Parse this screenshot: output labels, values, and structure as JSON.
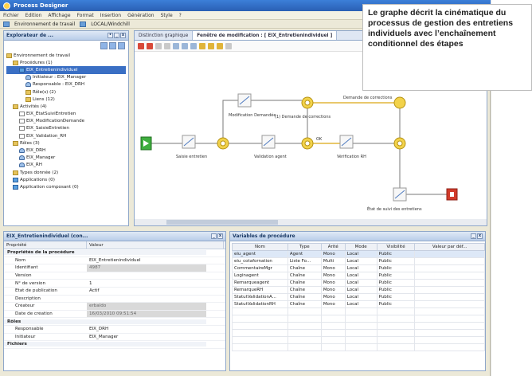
{
  "window": {
    "title": "Process Designer"
  },
  "menu": [
    "Fichier",
    "Edition",
    "Affichage",
    "Format",
    "Insertion",
    "Génération",
    "Style",
    "?"
  ],
  "workspace_bar": {
    "label": "Environnement de travail",
    "path": "LOCAL/Windchill"
  },
  "explorer": {
    "title": "Explorateur de ...",
    "tree": [
      {
        "label": "Environnement de travail",
        "depth": 0,
        "icon": "folder-icon"
      },
      {
        "label": "Procédures (1)",
        "depth": 1,
        "icon": "folder-icon"
      },
      {
        "label": "EIX_Entretienindividuel",
        "depth": 2,
        "icon": "process-icon",
        "selected": true
      },
      {
        "label": "Initiateur : EIX_Manager",
        "depth": 3,
        "icon": "person-icon"
      },
      {
        "label": "Responsable : EIX_DRH",
        "depth": 3,
        "icon": "person-icon"
      },
      {
        "label": "Rôle(s) (2)",
        "depth": 3,
        "icon": "folder-icon"
      },
      {
        "label": "Liens (12)",
        "depth": 3,
        "icon": "folder-icon"
      },
      {
        "label": "Activités (4)",
        "depth": 1,
        "icon": "folder-icon"
      },
      {
        "label": "EIX_ÉtatSuiviEntretien",
        "depth": 2,
        "icon": "document-icon"
      },
      {
        "label": "EIX_ModificationDemande",
        "depth": 2,
        "icon": "document-icon"
      },
      {
        "label": "EIX_SaisieEntretien",
        "depth": 2,
        "icon": "document-icon"
      },
      {
        "label": "EIX_Validation_RH",
        "depth": 2,
        "icon": "document-icon"
      },
      {
        "label": "Rôles (3)",
        "depth": 1,
        "icon": "folder-icon"
      },
      {
        "label": "EIX_DRH",
        "depth": 2,
        "icon": "person-icon"
      },
      {
        "label": "EIX_Manager",
        "depth": 2,
        "icon": "person-icon"
      },
      {
        "label": "EIX_RH",
        "depth": 2,
        "icon": "person-icon"
      },
      {
        "label": "Types donnée (2)",
        "depth": 1,
        "icon": "folder-icon"
      },
      {
        "label": "Applications (0)",
        "depth": 1,
        "icon": "database-icon"
      },
      {
        "label": "Application composant (0)",
        "depth": 1,
        "icon": "database-icon"
      }
    ]
  },
  "editor": {
    "tabs": [
      "Distinction graphique",
      "Fenêtre de modification : [ EIX_Entretienindividuel ]"
    ],
    "nodes": {
      "start": "",
      "saisie": "Saisie entretien",
      "validation": "Validation agent",
      "modification": "Modification Demandée",
      "verification": "Vérification RH",
      "etat": "État de suivi des entretiens",
      "end": ""
    },
    "edge_labels": {
      "demande": "(1) Demande de corrections",
      "demande_top": "Demande de corrections",
      "ok": "OK"
    }
  },
  "callout": {
    "text": "Le graphe décrit la cinématique du processus de gestion des entretiens individuels avec l’enchaînement conditionnel des étapes"
  },
  "properties": {
    "title": "EIX_Entretienindividuel (con...",
    "columns": [
      "Propriété",
      "Valeur"
    ],
    "rows": [
      {
        "key": "Propriétés de la procédure",
        "value": "",
        "group": true
      },
      {
        "key": "Nom",
        "value": "EIX_Entretienindividuel",
        "group": false,
        "ro": false
      },
      {
        "key": "Identifiant",
        "value": "4987",
        "group": false,
        "ro": true
      },
      {
        "key": "Version",
        "value": "",
        "group": false,
        "ro": false
      },
      {
        "key": "N° de version",
        "value": "1",
        "group": false,
        "ro": false
      },
      {
        "key": "État de publication",
        "value": "Actif",
        "group": false,
        "ro": false
      },
      {
        "key": "Description",
        "value": "",
        "group": false,
        "ro": false
      },
      {
        "key": "Créateur",
        "value": "erbaldo",
        "group": false,
        "ro": true
      },
      {
        "key": "Date de création",
        "value": "16/03/2010 09:51:54",
        "group": false,
        "ro": true
      },
      {
        "key": "Rôles",
        "value": "",
        "group": true
      },
      {
        "key": "Responsable",
        "value": "EIX_DRH",
        "group": false,
        "ro": false
      },
      {
        "key": "Initiateur",
        "value": "EIX_Manager",
        "group": false,
        "ro": false
      },
      {
        "key": "Fichiers",
        "value": "",
        "group": true
      }
    ]
  },
  "variables": {
    "title": "Variables de procédure",
    "columns": [
      "Nom",
      "Type",
      "Arité",
      "Mode",
      "Visibilité",
      "Valeur par déf..."
    ],
    "rows": [
      [
        "eiu_agent",
        "Agent",
        "Mono",
        "Local",
        "Public",
        ""
      ],
      [
        "eiu_cotafornation",
        "Liste Fo...",
        "Multi",
        "Local",
        "Public",
        ""
      ],
      [
        "CommentaireMgr",
        "Chaîne",
        "Mono",
        "Local",
        "Public",
        ""
      ],
      [
        "Loginagent",
        "Chaîne",
        "Mono",
        "Local",
        "Public",
        ""
      ],
      [
        "Remarqueagent",
        "Chaîne",
        "Mono",
        "Local",
        "Public",
        ""
      ],
      [
        "RemarqueRH",
        "Chaîne",
        "Mono",
        "Local",
        "Public",
        ""
      ],
      [
        "StatutValidationA...",
        "Chaîne",
        "Mono",
        "Local",
        "Public",
        ""
      ],
      [
        "StatutValidationRH",
        "Chaîne",
        "Mono",
        "Local",
        "Public",
        ""
      ]
    ]
  }
}
